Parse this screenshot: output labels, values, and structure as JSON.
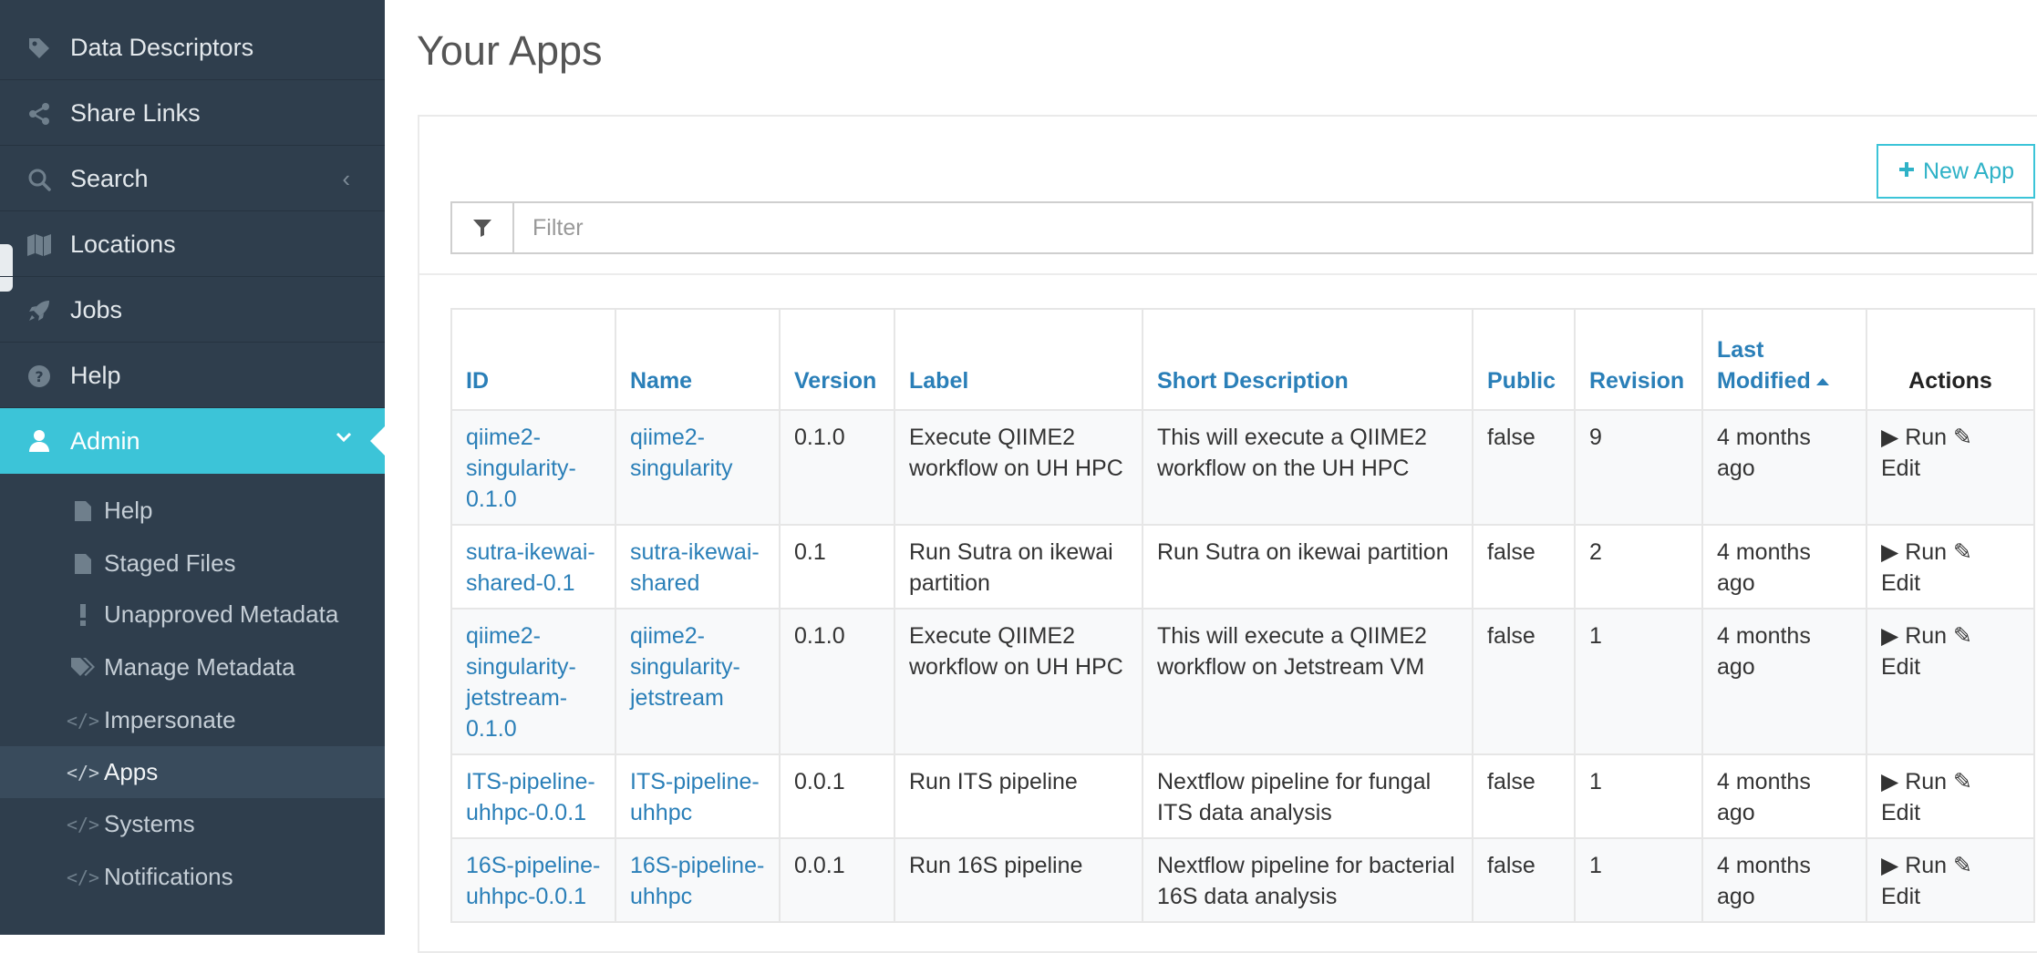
{
  "sidebar": {
    "items": [
      {
        "label": "Data Descriptors",
        "icon": "tag-icon"
      },
      {
        "label": "Share Links",
        "icon": "share-icon"
      },
      {
        "label": "Search",
        "icon": "search-icon",
        "chevron": "‹"
      },
      {
        "label": "Locations",
        "icon": "map-icon"
      },
      {
        "label": "Jobs",
        "icon": "rocket-icon"
      },
      {
        "label": "Help",
        "icon": "question-circle-icon"
      },
      {
        "label": "Admin",
        "icon": "user-icon",
        "chevron": "⌄"
      }
    ],
    "admin_items": [
      {
        "label": "Help",
        "icon": "file-icon"
      },
      {
        "label": "Staged Files",
        "icon": "file-icon"
      },
      {
        "label": "Unapproved Metadata",
        "icon": "exclamation-icon"
      },
      {
        "label": "Manage Metadata",
        "icon": "tags-icon"
      },
      {
        "label": "Impersonate",
        "icon": "code-icon"
      },
      {
        "label": "Apps",
        "icon": "code-icon"
      },
      {
        "label": "Systems",
        "icon": "code-icon"
      },
      {
        "label": "Notifications",
        "icon": "code-icon"
      }
    ]
  },
  "page": {
    "title": "Your Apps",
    "new_app_label": "New App",
    "filter_placeholder": "Filter"
  },
  "table": {
    "columns": [
      "ID",
      "Name",
      "Version",
      "Label",
      "Short Description",
      "Public",
      "Revision",
      "Last Modified",
      "Actions"
    ],
    "run_label": "Run",
    "edit_label": "Edit",
    "rows": [
      {
        "id": "qiime2-singularity-0.1.0",
        "name": "qiime2-singularity",
        "version": "0.1.0",
        "label": "Execute QIIME2 workflow on UH HPC",
        "description": "This will execute a QIIME2 workflow on the UH HPC",
        "public": "false",
        "revision": "9",
        "modified": "4 months ago"
      },
      {
        "id": "sutra-ikewai-shared-0.1",
        "name": "sutra-ikewai-shared",
        "version": "0.1",
        "label": "Run Sutra on ikewai partition",
        "description": "Run Sutra on ikewai partition",
        "public": "false",
        "revision": "2",
        "modified": "4 months ago"
      },
      {
        "id": "qiime2-singularity-jetstream-0.1.0",
        "name": "qiime2-singularity-jetstream",
        "version": "0.1.0",
        "label": "Execute QIIME2 workflow on UH HPC",
        "description": "This will execute a QIIME2 workflow on Jetstream VM",
        "public": "false",
        "revision": "1",
        "modified": "4 months ago"
      },
      {
        "id": "ITS-pipeline-uhhpc-0.0.1",
        "name": "ITS-pipeline-uhhpc",
        "version": "0.0.1",
        "label": "Run ITS pipeline",
        "description": "Nextflow pipeline for fungal ITS data analysis",
        "public": "false",
        "revision": "1",
        "modified": "4 months ago"
      },
      {
        "id": "16S-pipeline-uhhpc-0.0.1",
        "name": "16S-pipeline-uhhpc",
        "version": "0.0.1",
        "label": "Run 16S pipeline",
        "description": "Nextflow pipeline for bacterial 16S data analysis",
        "public": "false",
        "revision": "1",
        "modified": "4 months ago"
      }
    ]
  }
}
